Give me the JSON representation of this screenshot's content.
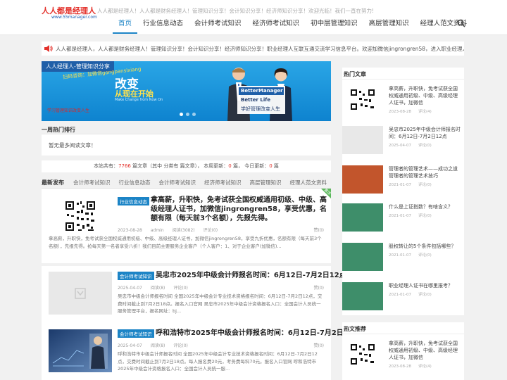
{
  "header": {
    "logo_main": "人人都是经理人",
    "logo_sub": "www.55manager.com",
    "tagline": "人人都是经理人！人人都是财务经理人！管理知识分享！会计知识分享！经济师知识分享！欢迎光临！我们一直在努力!",
    "nav": [
      {
        "label": "首页",
        "active": true
      },
      {
        "label": "行业信息动态"
      },
      {
        "label": "会计师考试知识"
      },
      {
        "label": "经济师考试知识"
      },
      {
        "label": "初中层管理知识"
      },
      {
        "label": "高层管理知识"
      },
      {
        "label": "经理人范文资料"
      }
    ]
  },
  "notice": {
    "text": "人人都是经理人，人人都是财务经理人！管理知识分享！会计知识分享！经济师知识分享！职业经理人互联互通交流学习信息平台。欢迎加微信jingrongren58，进入职业经理人微信群交流。"
  },
  "banner": {
    "tag": "人人经理人-管理知识分享",
    "ticker": "扫码咨询：加微信gongpansixiang",
    "big": "改变",
    "sub": "从现在开始",
    "eng": "Make Change from Now On",
    "red": "学习管理知识改变人生",
    "bm1": "BetterManager",
    "bm2": "Better Life",
    "bm3": "学好管理改变人生"
  },
  "ranking": {
    "title": "一周热门排行",
    "empty": "暂无最多阅读文章！"
  },
  "stats": {
    "p1": "本站共有：",
    "total": "7766",
    "p2": " 篇文章（其中 分类有 篇文章）， 本周更新：",
    "week": "0",
    "p3": " 篇， 今日更新：",
    "today": "0",
    "p4": " 篇"
  },
  "latest": {
    "title": "最新发布",
    "tabs": [
      "会计师考试知识",
      "行业信息动态",
      "会计师考试知识",
      "经济师考试知识",
      "高层管理知识",
      "经理人范文资料"
    ]
  },
  "posts": [
    {
      "category": "行业信息动态",
      "title": "拿高薪，升职快，免考试获全国权威通用初级、中级、高级经理人证书，加微信jingrongren58，享受优惠，名额有限（每天前3个名额），先报先得。",
      "date": "2023-08-28",
      "author": "admin",
      "views": "阅读(3082)",
      "comments": "评论(0)",
      "likes": "赞(0)",
      "excerpt": "拿高薪，升职快，免考试获全国权威通用初级、中级、高级经理人证书，加微信jingrongren58，享受九折优惠，名额有限（每天前3个名额），先报先得。抢每天第一名者享受八折！我们目前主要服务企业客户（个人客户：1、对于企业客户(加微信)...",
      "top": "置顶"
    },
    {
      "category": "会计师考试知识",
      "title": "吴忠市2025年中级会计师报名时间：6月12日-7月2日12点",
      "date": "2025-04-07",
      "views": "阅读(8)",
      "comments": "评论(0)",
      "likes": "赞(0)",
      "excerpt": "吴忠市中级会计师报名时间 全国2025年中级会计专业技术资格报名时间：6月12日-7月2日12点，交费时间截止到7月2日18点。报名入口官网 吴忠市2025年中级会计资格报名入口：全国会计人员统一服务管理平台，报名网址：bj..."
    },
    {
      "category": "会计师考试知识",
      "title": "呼和浩特市2025年中级会计师报名时间：6月12日-7月2日12点",
      "date": "2025-04-07",
      "views": "阅读(8)",
      "comments": "评论(0)",
      "likes": "赞(0)",
      "excerpt": "呼和浩特市中级会计师报名时间 全国2025年中级会计专业技术资格报名时间：6月12日-7月2日12点，交费时间截止到7月2日18点。每人报名费20元，考务费每科70元。报名入口官网 呼和浩特市2025年中级会计资格报名入口：全国会计人员统一服..."
    }
  ],
  "hot": {
    "title": "热门文章",
    "items": [
      {
        "text": "拿高薪，升职快，免考试获全国权威通用初级、中级、高级经理人证书，加微信jingrongren58，...",
        "date": "2023-08-28",
        "c": "评论(4)"
      },
      {
        "text": "吴忠市2025年中级会计师报名时间：6月12日-7月2日12点",
        "date": "2025-04-07",
        "c": "评论(0)"
      },
      {
        "text": "管理者的管理艺术——成功之道管理者的管理艺术技巧",
        "date": "2021-01-07",
        "c": "评论(0)"
      },
      {
        "text": "什么是上证指数？有啥含义？",
        "date": "2021-01-07",
        "c": "评论(0)"
      },
      {
        "text": "股权转让的5个条件包括哪些？",
        "date": "2021-01-07",
        "c": "评论(0)"
      },
      {
        "text": "职业经理人证书在哪里报考？",
        "date": "2021-01-07",
        "c": "评论(0)"
      }
    ]
  },
  "recommend": {
    "title": "热文推荐",
    "items": [
      {
        "text": "拿高薪，升职快，免考试获全国权威通用初级、中级、高级经理人证书，加微信jingrongren58，...",
        "date": "2023-08-28",
        "c": "评论(4)"
      }
    ]
  },
  "colors": {
    "accent": "#1c84c6",
    "red": "#e3312b",
    "green": "#3e8e6a",
    "brown": "#c2552c"
  }
}
